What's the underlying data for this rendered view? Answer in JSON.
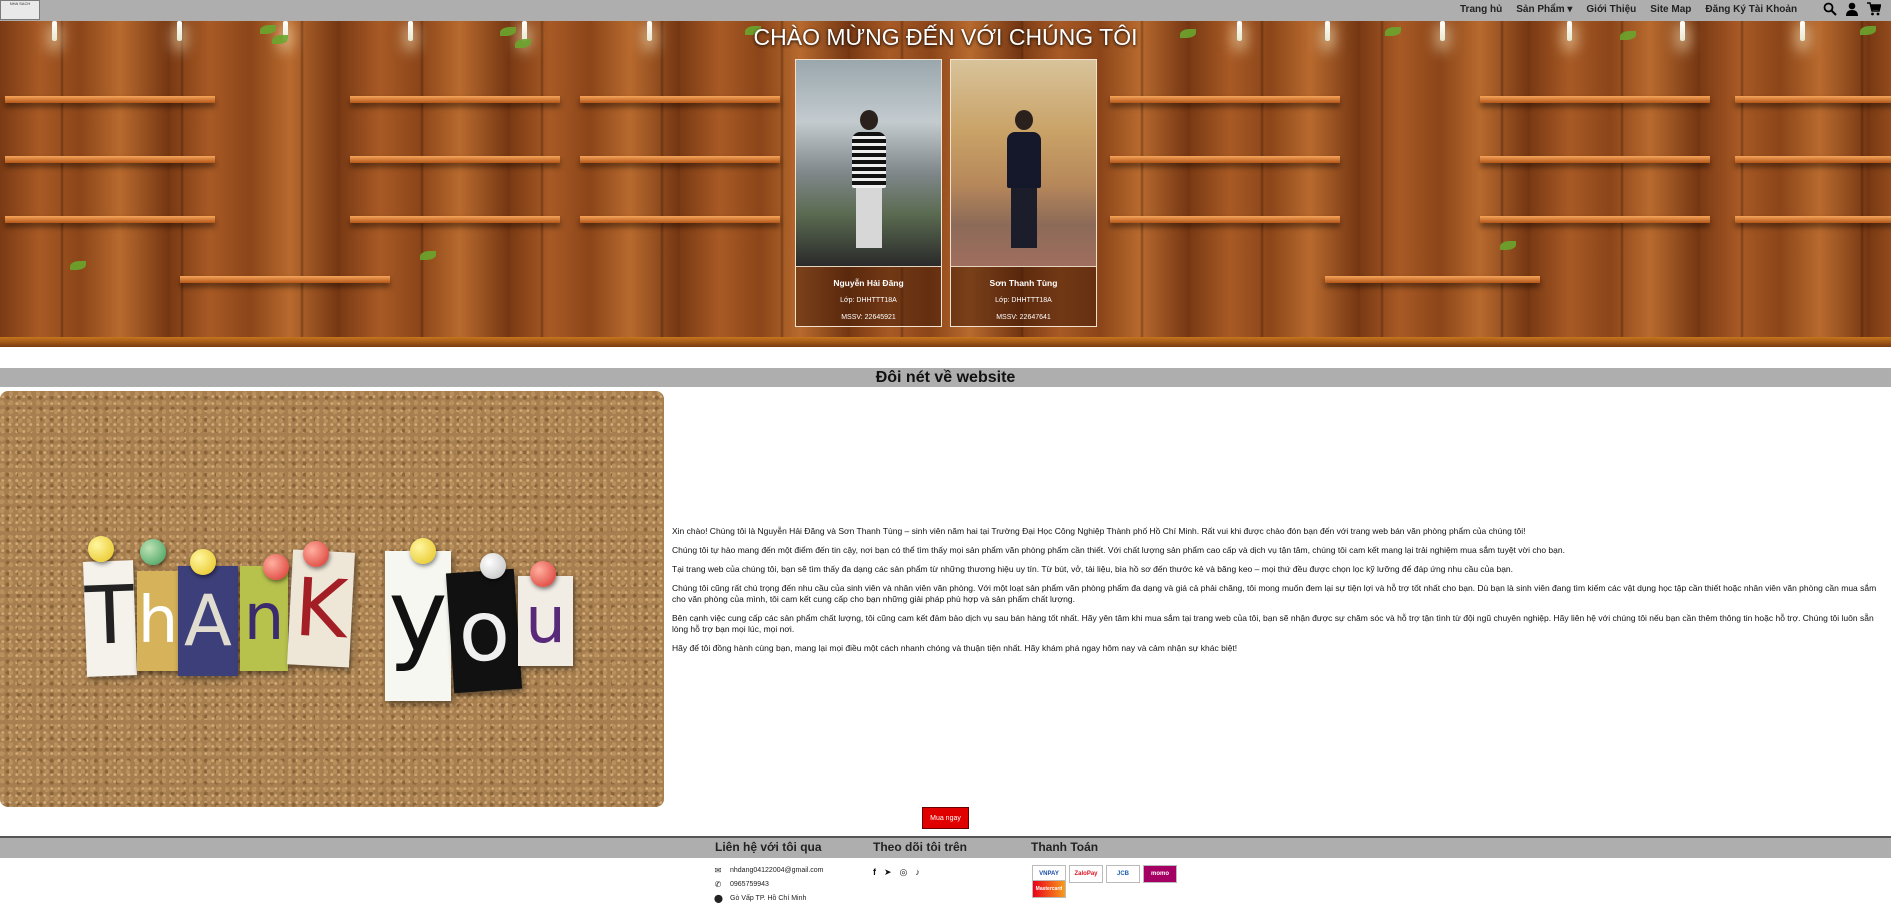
{
  "nav": {
    "logo_text": "NHA SACH",
    "items": [
      {
        "label": "Trang hủ"
      },
      {
        "label": "Sản Phẩm ▾"
      },
      {
        "label": "Giới Thiệu"
      },
      {
        "label": "Site Map"
      },
      {
        "label": "Đăng Ký Tài Khoản"
      }
    ],
    "icons": [
      "search-icon",
      "user-icon",
      "cart-icon"
    ]
  },
  "hero": {
    "title": "CHÀO MỪNG ĐẾN VỚI CHÚNG TÔI",
    "members": [
      {
        "name": "Nguyễn Hải Đăng",
        "class": "Lớp: DHHTTT18A",
        "id": "MSSV: 22645921"
      },
      {
        "name": "Sơn Thanh Tùng",
        "class": "Lớp: DHHTTT18A",
        "id": "MSSV: 22647641"
      }
    ]
  },
  "about": {
    "heading": "Đôi nét về website",
    "paragraphs": [
      "Xin chào! Chúng tôi là Nguyễn Hải Đăng và Sơn Thanh Tùng – sinh viên năm hai tại Trường Đại Học Công Nghiệp Thành phố Hồ Chí Minh. Rất vui khi được chào đón bạn đến với trang web bán văn phòng phẩm của chúng tôi!",
      "Chúng tôi tự hào mang đến một điểm đến tin cậy, nơi bạn có thể tìm thấy mọi sản phẩm văn phòng phẩm cần thiết. Với chất lượng sản phẩm cao cấp và dịch vụ tận tâm, chúng tôi cam kết mang lại trải nghiệm mua sắm tuyệt vời cho bạn.",
      "Tại trang web của chúng tôi, bạn sẽ tìm thấy đa dạng các sản phẩm từ những thương hiệu uy tín. Từ bút, vở, tài liệu, bìa hồ sơ đến thước kẻ và băng keo – mọi thứ đều được chọn lọc kỹ lưỡng để đáp ứng nhu cầu của bạn.",
      "Chúng tôi cũng rất chú trọng đến nhu cầu của sinh viên và nhân viên văn phòng. Với một loạt sản phẩm văn phòng phẩm đa dạng và giá cả phải chăng, tôi mong muốn đem lại sự tiện lợi và hỗ trợ tốt nhất cho bạn. Dù bạn là sinh viên đang tìm kiếm các vật dụng học tập cần thiết hoặc nhân viên văn phòng cần mua sắm cho văn phòng của mình, tôi cam kết cung cấp cho bạn những giải pháp phù hợp và sản phẩm chất lượng.",
      "Bên cạnh việc cung cấp các sản phẩm chất lượng, tôi cũng cam kết đảm bảo dịch vụ sau bán hàng tốt nhất. Hãy yên tâm khi mua sắm tại trang web của tôi, bạn sẽ nhận được sự chăm sóc và hỗ trợ tận tình từ đội ngũ chuyên nghiệp. Hãy liên hệ với chúng tôi nếu bạn cần thêm thông tin hoặc hỗ trợ. Chúng tôi luôn sẵn lòng hỗ trợ bạn mọi lúc, mọi nơi.",
      "Hãy để tôi đồng hành cùng bạn, mang lại mọi điều một cách nhanh chóng và thuận tiện nhất. Hãy khám phá ngay hôm nay và cảm nhận sự khác biệt!"
    ],
    "image_letters": [
      "T",
      "h",
      "A",
      "n",
      "K",
      "y",
      "o",
      "u"
    ],
    "buy_label": "Mua ngay"
  },
  "footer": {
    "contact_heading": "Liên hệ với tôi qua",
    "email": "nhdang04122004@gmail.com",
    "phone": "0965759943",
    "address": "Gò Vấp TP. Hồ Chí Minh",
    "follow_heading": "Theo dõi tôi trên",
    "social_icons": [
      "facebook-icon",
      "telegram-icon",
      "instagram-icon",
      "tiktok-icon"
    ],
    "payment_heading": "Thanh Toán",
    "payments": [
      "VNPAY",
      "ZaloPay",
      "JCB",
      "momo",
      "Mastercard"
    ]
  },
  "colors": {
    "nav_bg": "#aeaeae",
    "buy_button": "#e00000"
  }
}
